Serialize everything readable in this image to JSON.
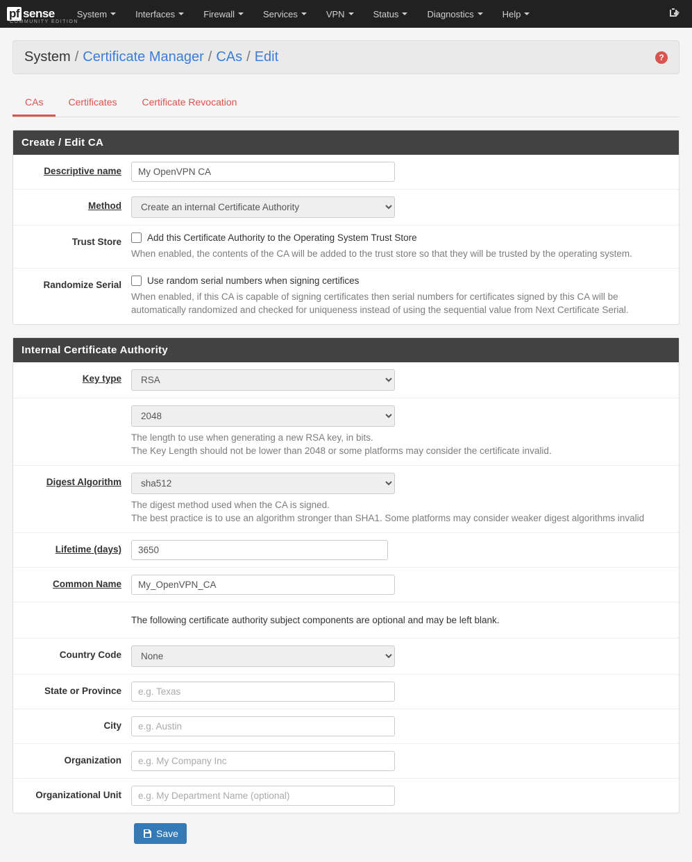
{
  "nav": {
    "items": [
      "System",
      "Interfaces",
      "Firewall",
      "Services",
      "VPN",
      "Status",
      "Diagnostics",
      "Help"
    ]
  },
  "breadcrumb": {
    "root": "System",
    "parts": [
      "Certificate Manager",
      "CAs",
      "Edit"
    ]
  },
  "tabs": [
    "CAs",
    "Certificates",
    "Certificate Revocation"
  ],
  "panel1": {
    "title": "Create / Edit CA",
    "descr_label": "Descriptive name",
    "descr_value": "My OpenVPN CA",
    "method_label": "Method",
    "method_value": "Create an internal Certificate Authority",
    "trust_label": "Trust Store",
    "trust_check": "Add this Certificate Authority to the Operating System Trust Store",
    "trust_help": "When enabled, the contents of the CA will be added to the trust store so that they will be trusted by the operating system.",
    "rand_label": "Randomize Serial",
    "rand_check": "Use random serial numbers when signing certifices",
    "rand_help": "When enabled, if this CA is capable of signing certificates then serial numbers for certificates signed by this CA will be automatically randomized and checked for uniqueness instead of using the sequential value from Next Certificate Serial."
  },
  "panel2": {
    "title": "Internal Certificate Authority",
    "keytype_label": "Key type",
    "keytype_value": "RSA",
    "keylen_value": "2048",
    "keylen_help1": "The length to use when generating a new RSA key, in bits.",
    "keylen_help2": "The Key Length should not be lower than 2048 or some platforms may consider the certificate invalid.",
    "digest_label": "Digest Algorithm",
    "digest_value": "sha512",
    "digest_help1": "The digest method used when the CA is signed.",
    "digest_help2": "The best practice is to use an algorithm stronger than SHA1. Some platforms may consider weaker digest algorithms invalid",
    "lifetime_label": "Lifetime (days)",
    "lifetime_value": "3650",
    "cn_label": "Common Name",
    "cn_value": "My_OpenVPN_CA",
    "optional_note": "The following certificate authority subject components are optional and may be left blank.",
    "country_label": "Country Code",
    "country_value": "None",
    "state_label": "State or Province",
    "state_ph": "e.g. Texas",
    "city_label": "City",
    "city_ph": "e.g. Austin",
    "org_label": "Organization",
    "org_ph": "e.g. My Company Inc",
    "ou_label": "Organizational Unit",
    "ou_ph": "e.g. My Department Name (optional)"
  },
  "buttons": {
    "save": "Save"
  }
}
